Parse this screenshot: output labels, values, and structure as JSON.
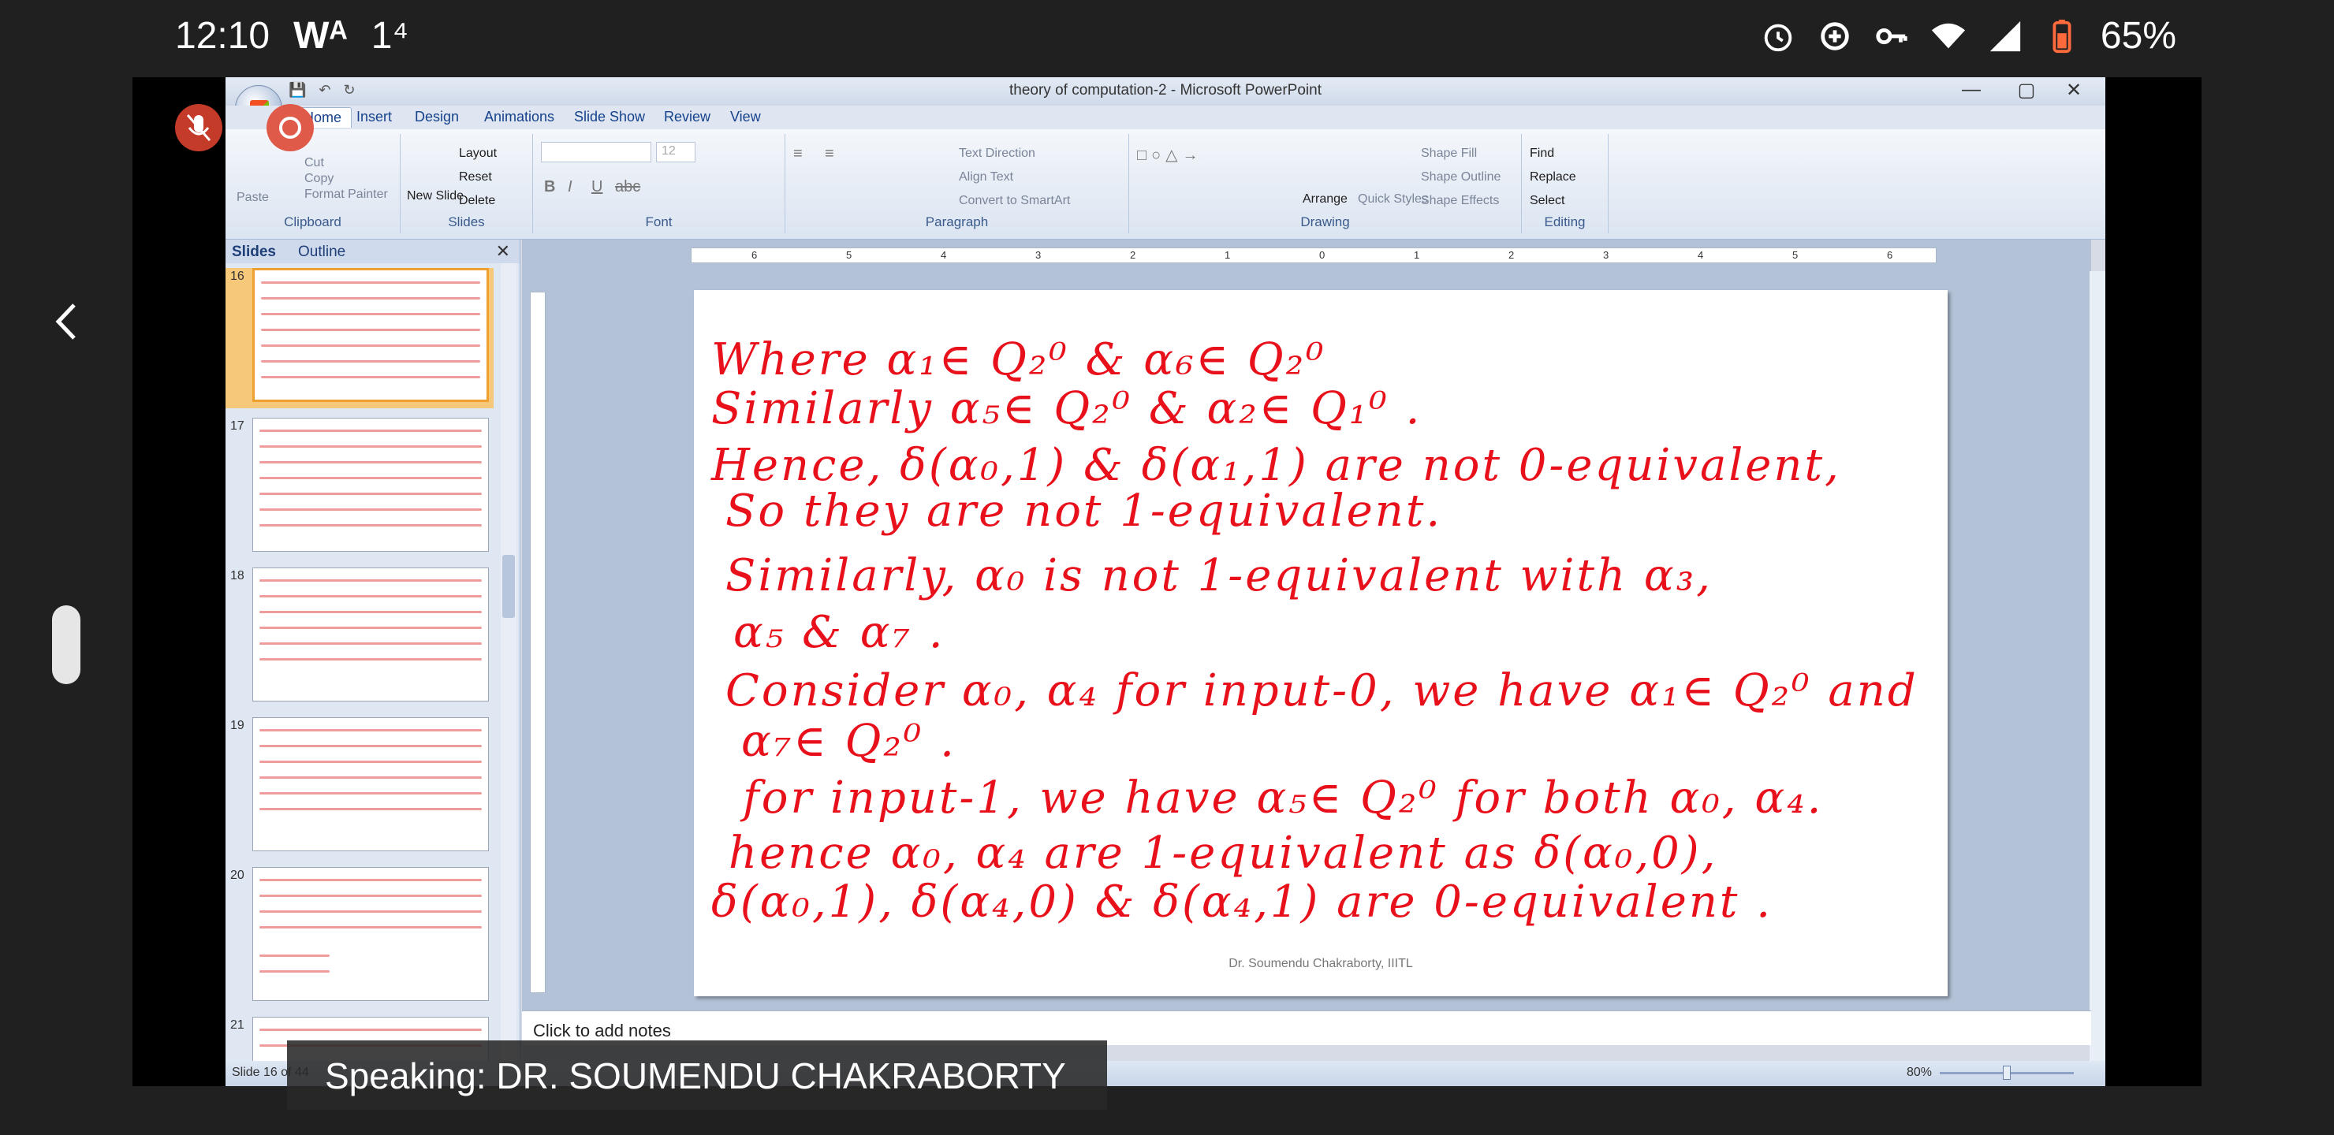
{
  "phone": {
    "time": "12:10",
    "notif_wb": "Wᴬ",
    "notif_1": "1⁴",
    "battery": "65%"
  },
  "window": {
    "title": "theory of computation-2 - Microsoft PowerPoint",
    "minimize": "—",
    "restore": "▢",
    "close": "✕"
  },
  "ribbon_tabs": [
    "Home",
    "Insert",
    "Design",
    "Animations",
    "Slide Show",
    "Review",
    "View"
  ],
  "ribbon": {
    "clipboard": {
      "label": "Clipboard",
      "paste": "Paste",
      "cut": "Cut",
      "copy": "Copy",
      "format_painter": "Format Painter"
    },
    "slides": {
      "label": "Slides",
      "new_slide": "New Slide",
      "layout": "Layout",
      "reset": "Reset",
      "delete": "Delete"
    },
    "font": {
      "label": "Font",
      "size": "12"
    },
    "paragraph": {
      "label": "Paragraph",
      "text_direction": "Text Direction",
      "align_text": "Align Text",
      "convert_smartart": "Convert to SmartArt"
    },
    "drawing": {
      "label": "Drawing",
      "arrange": "Arrange",
      "quick_styles": "Quick Styles",
      "shape_fill": "Shape Fill",
      "shape_outline": "Shape Outline",
      "shape_effects": "Shape Effects"
    },
    "editing": {
      "label": "Editing",
      "find": "Find",
      "replace": "Replace",
      "select": "Select"
    }
  },
  "pane": {
    "tab_slides": "Slides",
    "tab_outline": "Outline",
    "close": "✕",
    "slide_numbers": [
      "16",
      "17",
      "18",
      "19",
      "20",
      "21"
    ]
  },
  "ruler_numbers": [
    "6",
    "5",
    "4",
    "3",
    "2",
    "1",
    "0",
    "1",
    "2",
    "3",
    "4",
    "5",
    "6"
  ],
  "slide": {
    "lines": [
      "Where α₁∈ Q₂⁰ & α₆∈ Q₂⁰",
      "Similarly α₅∈ Q₂⁰ & α₂∈ Q₁⁰ .",
      "Hence, δ(α₀,1) & δ(α₁,1) are not 0-equivalent,",
      "So they are not 1-equivalent.",
      "Similarly, α₀ is not 1-equivalent with α₃,",
      "α₅ & α₇ .",
      "Consider α₀, α₄ for input-0, we have α₁∈ Q₂⁰ and",
      "α₇∈ Q₂⁰ .",
      "for input-1, we have α₅∈ Q₂⁰ for both α₀, α₄.",
      "hence α₀, α₄ are 1-equivalent as δ(α₀,0),",
      "δ(α₀,1), δ(α₄,0) & δ(α₄,1) are 0-equivalent ."
    ],
    "footer": "Dr. Soumendu Chakraborty, IIITL"
  },
  "notes_placeholder": "Click to add notes",
  "statusbar": {
    "slide_info": "Slide 16 of 44",
    "zoom": "80%"
  },
  "caption": "Speaking: DR. SOUMENDU CHAKRABORTY",
  "colors": {
    "ink": "#e8101a",
    "ribbon_text": "#15428b"
  }
}
